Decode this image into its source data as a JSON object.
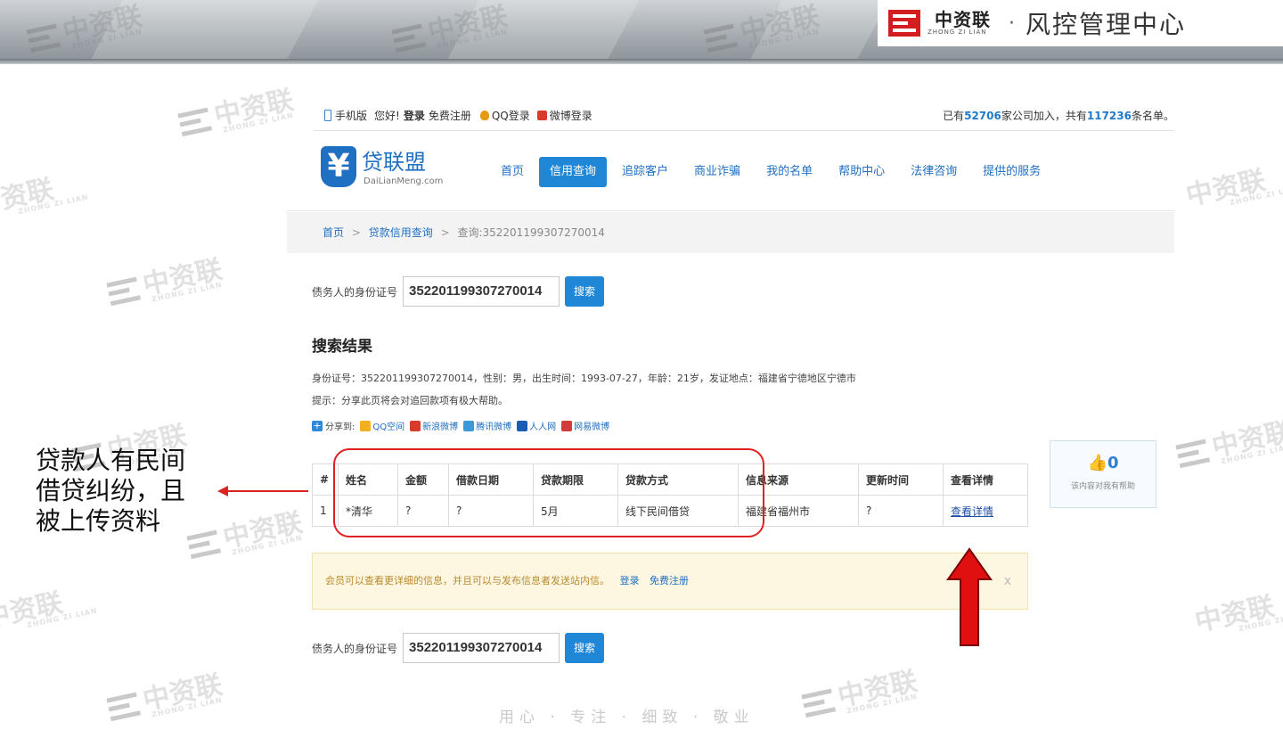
{
  "slide": {
    "brand_cn": "中资联",
    "brand_pinyin": "ZHONG ZI LIAN",
    "separator": "·",
    "title": "风控管理中心",
    "watermark_cn": "中资联",
    "watermark_en": "ZHONG ZI LIAN",
    "footer_slogan": "用心 · 专注 · 细致 · 敬业"
  },
  "topbar": {
    "mobile": "手机版",
    "greeting": "您好!",
    "login": "登录",
    "register": "免费注册",
    "qq_login": "QQ登录",
    "weibo_login": "微博登录",
    "stats_prefix": "已有",
    "company_count": "52706",
    "stats_mid": "家公司加入，共有",
    "list_count": "117236",
    "stats_suffix": "条名单。"
  },
  "logo": {
    "symbol": "¥",
    "name": "贷联盟",
    "domain": "DaiLianMeng.com"
  },
  "nav": {
    "items": [
      {
        "label": "首页"
      },
      {
        "label": "信用查询"
      },
      {
        "label": "追踪客户"
      },
      {
        "label": "商业诈骗"
      },
      {
        "label": "我的名单"
      },
      {
        "label": "帮助中心"
      },
      {
        "label": "法律咨询"
      },
      {
        "label": "提供的服务"
      }
    ],
    "active": "信用查询"
  },
  "breadcrumb": {
    "home": "首页",
    "sep": ">",
    "section": "贷款信用查询",
    "current": "查询:352201199307270014"
  },
  "search": {
    "label": "债务人的身份证号",
    "value": "352201199307270014",
    "button": "搜索"
  },
  "results": {
    "title": "搜索结果",
    "info": "身份证号：352201199307270014，性别：男，出生时间：1993-07-27，年龄：21岁，发证地点：福建省宁德地区宁德市",
    "tip": "提示：分享此页将会对追回款项有极大帮助。",
    "share_label": "分享到:",
    "share_targets": [
      "QQ空间",
      "新浪微博",
      "腾讯微博",
      "人人网",
      "网易微博"
    ],
    "columns": [
      "#",
      "姓名",
      "金额",
      "借款日期",
      "贷款期限",
      "贷款方式",
      "信息来源",
      "更新时间",
      "查看详情"
    ],
    "rows": [
      [
        "1",
        "*清华",
        "?",
        "?",
        "5月",
        "线下民间借贷",
        "福建省福州市",
        "?",
        "查看详情"
      ]
    ]
  },
  "help": {
    "count": "0",
    "text": "该内容对我有帮助"
  },
  "notice": {
    "text": "会员可以查看更详细的信息，并且可以与发布信息者发送站内信。",
    "login": "登录",
    "register": "免费注册",
    "close": "x"
  },
  "annotation": {
    "line1": "贷款人有民间",
    "line2": "借贷纠纷，且",
    "line3": "被上传资料"
  },
  "colors": {
    "accent": "#1f87d6",
    "link": "#1f6fc2",
    "highlight": "#e02020"
  }
}
